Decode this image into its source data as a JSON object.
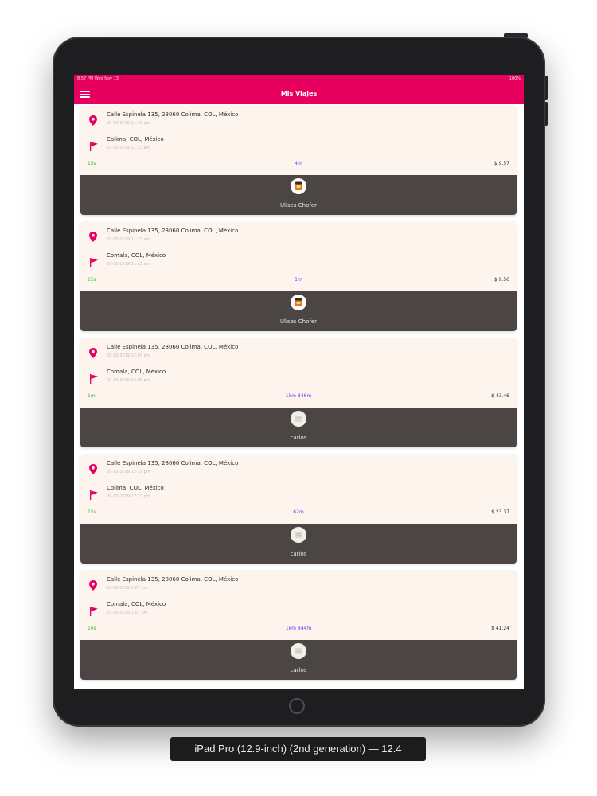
{
  "statusbar": {
    "time_date": "8:57 PM   Wed Nov 13",
    "battery": "100%"
  },
  "header": {
    "title": "Mis Viajes",
    "menu_icon": "hamburger-menu-icon"
  },
  "icons": {
    "origin": "location-pin-icon",
    "destination": "flag-icon"
  },
  "colors": {
    "accent": "#e8005e",
    "card_background": "#fdf4ee",
    "driver_panel": "#4b4643",
    "time_text": "#3dba3d",
    "distance_text": "#6a3df0"
  },
  "trips": [
    {
      "origin": "Calle Espinela 135, 28060 Colima, COL, México",
      "origin_date": "29-10-2019 11:23 am",
      "destination": "Colima, COL, México",
      "destination_date": "29-10-2019 11:23 am",
      "time": "15s",
      "distance": "4m",
      "price": "$ 9.57",
      "driver": "Ulises Chofer",
      "avatar": "driver-photo"
    },
    {
      "origin": "Calle Espinela 135, 28060 Colima, COL, México",
      "origin_date": "29-10-2019 11:23 am",
      "destination": "Comala, COL, México",
      "destination_date": "29-10-2019 11:23 am",
      "time": "15s",
      "distance": "1m",
      "price": "$ 9.56",
      "driver": "Ulises Chofer",
      "avatar": "driver-photo"
    },
    {
      "origin": "Calle Espinela 135, 28060 Colima, COL, México",
      "origin_date": "29-10-2019 12:07 pm",
      "destination": "Comala, COL, México",
      "destination_date": "29-10-2019 12:08 pm",
      "time": "1m",
      "distance": "1km 846m",
      "price": "$ 43.46",
      "driver": "carlos",
      "avatar": "driver-placeholder"
    },
    {
      "origin": "Calle Espinela 135, 28060 Colima, COL, México",
      "origin_date": "29-10-2019 12:18 pm",
      "destination": "Colima, COL, México",
      "destination_date": "29-10-2019 12:19 pm",
      "time": "15s",
      "distance": "62m",
      "price": "$ 23.37",
      "driver": "carlos",
      "avatar": "driver-placeholder"
    },
    {
      "origin": "Calle Espinela 135, 28060 Colima, COL, México",
      "origin_date": "29-10-2019 1:07 pm",
      "destination": "Comala, COL, México",
      "destination_date": "29-10-2019 1:07 pm",
      "time": "16s",
      "distance": "1km 844m",
      "price": "$ 41.24",
      "driver": "carlos",
      "avatar": "driver-placeholder"
    }
  ],
  "simulator_caption": "iPad Pro (12.9-inch) (2nd generation) — 12.4"
}
